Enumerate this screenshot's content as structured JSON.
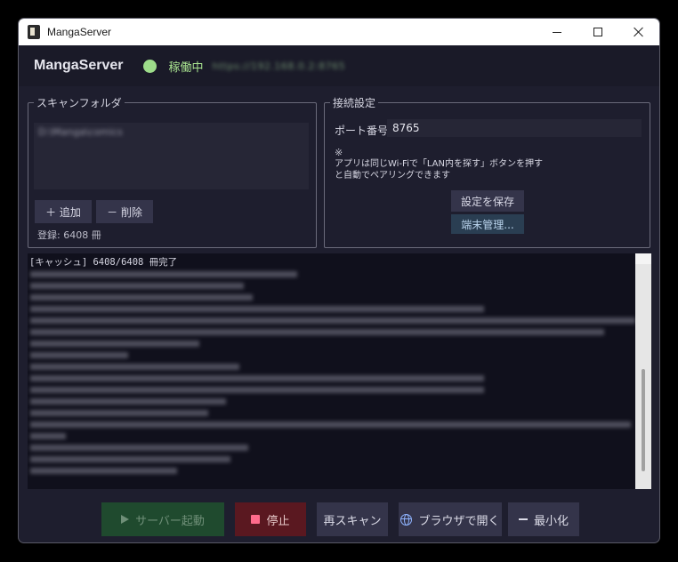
{
  "window": {
    "title": "MangaServer"
  },
  "header": {
    "app_title": "MangaServer",
    "status_text": "稼働中",
    "status_url": "https://192.168.0.2:8765",
    "status_color": "#9ddc8a"
  },
  "scan_folder": {
    "legend": "スキャンフォルダ",
    "items": [
      "D:\\Manga\\comics"
    ],
    "add_label": "＋ 追加",
    "delete_label": "－ 削除",
    "registered": "登録: 6408 冊"
  },
  "connection": {
    "legend": "接続設定",
    "port_label": "ポート番号",
    "port_value": "8765",
    "note_mark": "※",
    "note_text": "アプリは同じWi-Fiで「LAN内を探す」ボタンを押すと自動でペアリングできます",
    "save_label": "設定を保存",
    "device_label": "端末管理..."
  },
  "log": {
    "first_line": "[キャッシュ] 6408/6408 冊完了"
  },
  "buttons": {
    "start": "サーバー起動",
    "stop": "停止",
    "rescan": "再スキャン",
    "browser": "ブラウザで開く",
    "minimize": "最小化"
  },
  "icons": {
    "app": "manga-app-icon",
    "start": "play-icon",
    "stop": "stop-icon",
    "browser": "globe-icon",
    "minimize": "dash-icon"
  },
  "colors": {
    "background": "#1e1e2e",
    "accent_green": "#9ddc8a",
    "stop_red": "#5a1820",
    "start_green": "#1f4a2e"
  }
}
